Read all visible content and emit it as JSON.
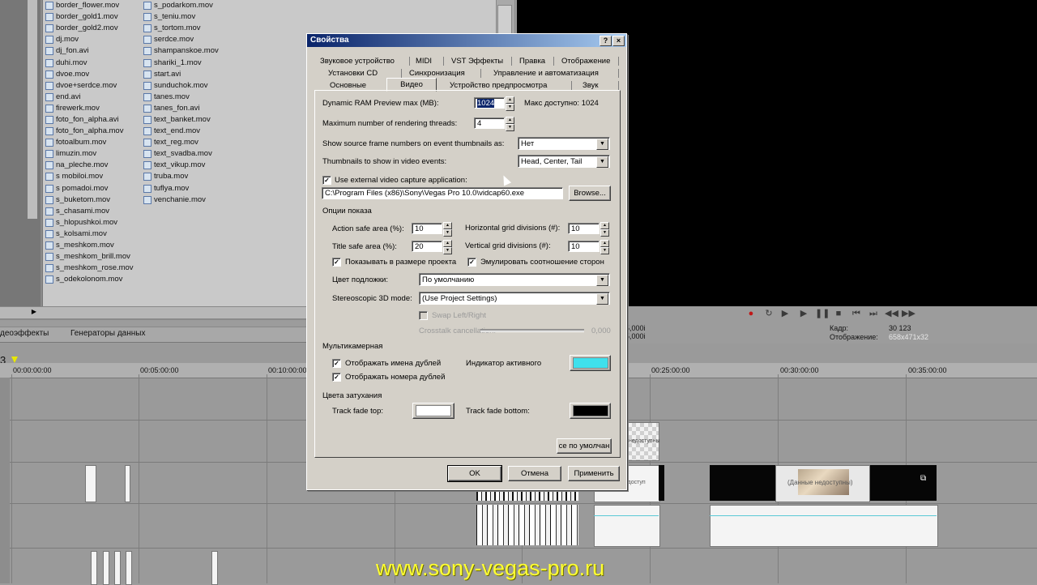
{
  "explorer": {
    "files_col1": [
      "border_flower.mov",
      "border_gold1.mov",
      "border_gold2.mov",
      "dj.mov",
      "dj_fon.avi",
      "duhi.mov",
      "dvoe.mov",
      "dvoe+serdce.mov",
      "end.avi",
      "firewerk.mov",
      "foto_fon_alpha.avi",
      "foto_fon_alpha.mov",
      "fotoalbum.mov",
      "limuzin.mov",
      "na_pleche.mov",
      "s mobiloi.mov",
      "s pomadoi.mov",
      "s_buketom.mov",
      "s_chasami.mov",
      "s_hlopushkoi.mov",
      "s_kolsami.mov",
      "s_meshkom.mov",
      "s_meshkom_brill.mov",
      "s_meshkom_rose.mov",
      "s_odekolonom.mov"
    ],
    "files_col2": [
      "s_podarkom.mov",
      "s_teniu.mov",
      "s_tortom.mov",
      "serdce.mov",
      "shampanskoe.mov",
      "shariki_1.mov",
      "start.avi",
      "sunduchok.mov",
      "tanes.mov",
      "tanes_fon.avi",
      "text_banket.mov",
      "text_end.mov",
      "text_reg.mov",
      "text_svadba.mov",
      "text_vikup.mov",
      "truba.mov",
      "tuflya.mov",
      "venchanie.mov"
    ],
    "tabs": [
      "деоэффекты",
      "Генераторы данных"
    ]
  },
  "preview": {
    "frame_label": "Кадр:",
    "frame_value": "30 123",
    "display_label": "Отображение:",
    "display_value": "658x471x32",
    "partial_values": [
      "5,000i",
      "5,000i"
    ],
    "transport_icons": [
      "record-icon",
      "loop-icon",
      "play-from-start-icon",
      "play-icon",
      "pause-icon",
      "stop-icon",
      "prev-frame-icon",
      "next-frame-icon",
      "rewind-icon",
      "fast-forward-icon"
    ]
  },
  "timeline": {
    "ruler_ticks": [
      "00:00:00:00",
      "00:05:00:00",
      "00:10:00:00",
      "00:25:00:00",
      "00:30:00:00",
      "00:35:00:00"
    ],
    "clip_text": [
      "(Данные недоступны)",
      "недоступны",
      "недоступ"
    ]
  },
  "watermark": "www.sony-vegas-pro.ru",
  "dialog": {
    "title": "Свойства",
    "help_btn": "?",
    "close_btn": "×",
    "tabs_row1": [
      "Звуковое устройство",
      "MIDI",
      "VST Эффекты",
      "Правка",
      "Отображение"
    ],
    "tabs_row2": [
      "Установки CD",
      "Синхронизация",
      "Управление и автоматизация"
    ],
    "tabs_row3": [
      "Основные",
      "Видео",
      "Устройство предпросмотра",
      "Звук"
    ],
    "ram_label": "Dynamic RAM Preview max (MB):",
    "ram_value": "1024",
    "ram_max": "Макс доступно: 1024",
    "threads_label": "Maximum number of rendering threads:",
    "threads_value": "4",
    "frame_numbers_label": "Show source frame numbers on event thumbnails as:",
    "frame_numbers_value": "Нет",
    "thumbnails_label": "Thumbnails to show in video events:",
    "thumbnails_value": "Head, Center, Tail",
    "external_capture_label": "Use external video capture application:",
    "external_capture_path": "C:\\Program Files (x86)\\Sony\\Vegas Pro 10.0\\vidcap60.exe",
    "browse_btn": "Browse...",
    "display_options_header": "Опции показа",
    "action_safe_label": "Action safe area (%):",
    "action_safe_value": "10",
    "title_safe_label": "Title safe area (%):",
    "title_safe_value": "20",
    "hgrid_label": "Horizontal grid divisions (#):",
    "hgrid_value": "10",
    "vgrid_label": "Vertical grid divisions (#):",
    "vgrid_value": "10",
    "show_project_size_label": "Показывать в размере проекта",
    "emulate_aspect_label": "Эмулировать соотношение сторон",
    "backdrop_label": "Цвет подложки:",
    "backdrop_value": "По умолчанию",
    "stereo_label": "Stereoscopic 3D mode:",
    "stereo_value": "(Use Project Settings)",
    "swap_label": "Swap Left/Right",
    "crosstalk_label": "Crosstalk cancellation:",
    "crosstalk_value": "0,000",
    "multicam_header": "Мультикамерная",
    "show_take_names_label": "Отображать имена дублей",
    "show_take_numbers_label": "Отображать номера дублей",
    "active_indicator_label": "Индикатор активного",
    "fade_header": "Цвета затухания",
    "fade_top_label": "Track fade top:",
    "fade_bottom_label": "Track fade bottom:",
    "defaults_btn": "се по умолчан",
    "ok_btn": "OK",
    "cancel_btn": "Отмена",
    "apply_btn": "Применить",
    "colors": {
      "active_indicator": "#3fe0ec",
      "fade_top": "#ffffff",
      "fade_bottom": "#000000"
    }
  }
}
